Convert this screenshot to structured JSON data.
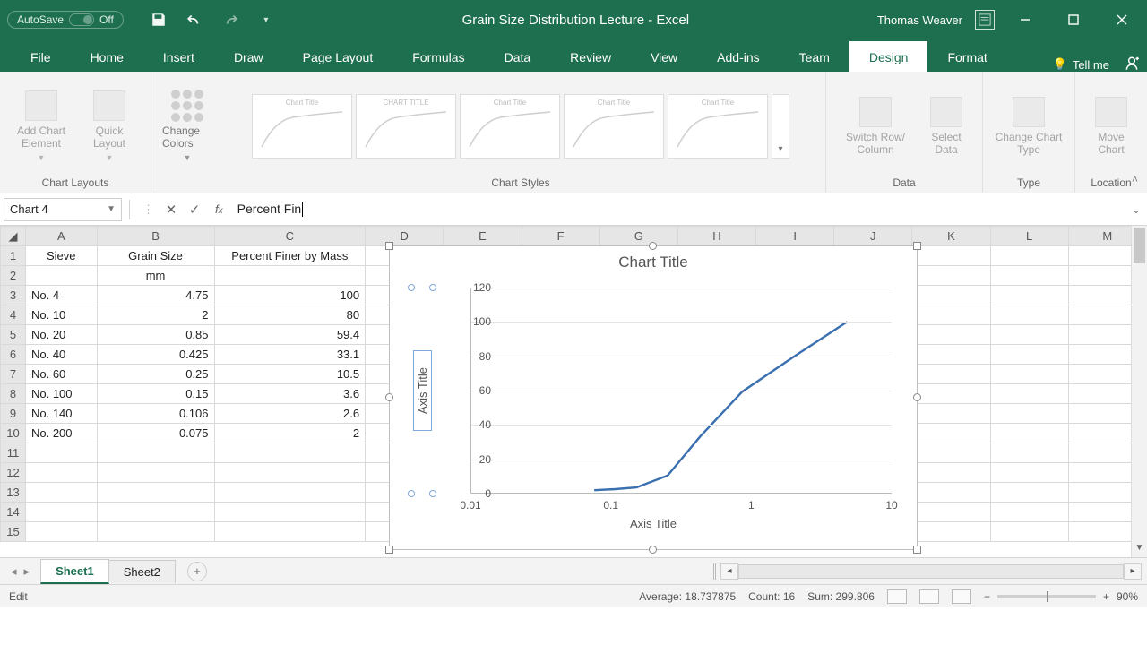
{
  "titlebar": {
    "autosave_label": "AutoSave",
    "autosave_state": "Off",
    "doc_title": "Grain Size Distribution Lecture  -  Excel",
    "user": "Thomas Weaver"
  },
  "tabs": {
    "items": [
      "File",
      "Home",
      "Insert",
      "Draw",
      "Page Layout",
      "Formulas",
      "Data",
      "Review",
      "View",
      "Add-ins",
      "Team",
      "Design",
      "Format"
    ],
    "active": "Design",
    "tellme": "Tell me"
  },
  "ribbon": {
    "chart_layouts": {
      "label": "Chart Layouts",
      "add_element": "Add Chart Element",
      "quick_layout": "Quick Layout"
    },
    "change_colors": "Change Colors",
    "chart_styles_label": "Chart Styles",
    "data_group": {
      "label": "Data",
      "switch": "Switch Row/ Column",
      "select": "Select Data"
    },
    "type_group": {
      "label": "Type",
      "change": "Change Chart Type"
    },
    "location_group": {
      "label": "Location",
      "move": "Move Chart"
    }
  },
  "namebox": "Chart 4",
  "formula": "Percent Fin",
  "columns": [
    "A",
    "B",
    "C",
    "D",
    "E",
    "F",
    "G",
    "H",
    "I",
    "J",
    "K",
    "L",
    "M"
  ],
  "headers": {
    "A1": "Sieve",
    "B1": "Grain Size",
    "C1": "Percent Finer by Mass",
    "B2": "mm"
  },
  "rows": [
    {
      "r": 3,
      "sieve": "No. 4",
      "size": 4.75,
      "pct": 100
    },
    {
      "r": 4,
      "sieve": "No. 10",
      "size": 2,
      "pct": 80
    },
    {
      "r": 5,
      "sieve": "No. 20",
      "size": 0.85,
      "pct": 59.4
    },
    {
      "r": 6,
      "sieve": "No. 40",
      "size": 0.425,
      "pct": 33.1
    },
    {
      "r": 7,
      "sieve": "No. 60",
      "size": 0.25,
      "pct": 10.5
    },
    {
      "r": 8,
      "sieve": "No. 100",
      "size": 0.15,
      "pct": 3.6
    },
    {
      "r": 9,
      "sieve": "No. 140",
      "size": 0.106,
      "pct": 2.6
    },
    {
      "r": 10,
      "sieve": "No. 200",
      "size": 0.075,
      "pct": 2
    }
  ],
  "extra_rows": [
    11,
    12,
    13,
    14,
    15
  ],
  "chart": {
    "title": "Chart Title",
    "x_axis_title": "Axis Title",
    "y_axis_title": "Axis Title",
    "y_ticks": [
      0,
      20,
      40,
      60,
      80,
      100,
      120
    ],
    "x_ticks": [
      "0.01",
      "0.1",
      "1",
      "10"
    ]
  },
  "chart_data": {
    "type": "line",
    "title": "Chart Title",
    "xlabel": "Axis Title",
    "ylabel": "Axis Title",
    "x_scale": "log",
    "xlim": [
      0.01,
      10
    ],
    "ylim": [
      0,
      120
    ],
    "series": [
      {
        "name": "Percent Finer by Mass",
        "x": [
          0.075,
          0.106,
          0.15,
          0.25,
          0.425,
          0.85,
          2,
          4.75
        ],
        "y": [
          2,
          2.6,
          3.6,
          10.5,
          33.1,
          59.4,
          80,
          100
        ]
      }
    ]
  },
  "sheets": {
    "items": [
      "Sheet1",
      "Sheet2"
    ],
    "active": "Sheet1"
  },
  "status": {
    "mode": "Edit",
    "average_label": "Average:",
    "average": "18.737875",
    "count_label": "Count:",
    "count": "16",
    "sum_label": "Sum:",
    "sum": "299.806",
    "zoom": "90%"
  }
}
